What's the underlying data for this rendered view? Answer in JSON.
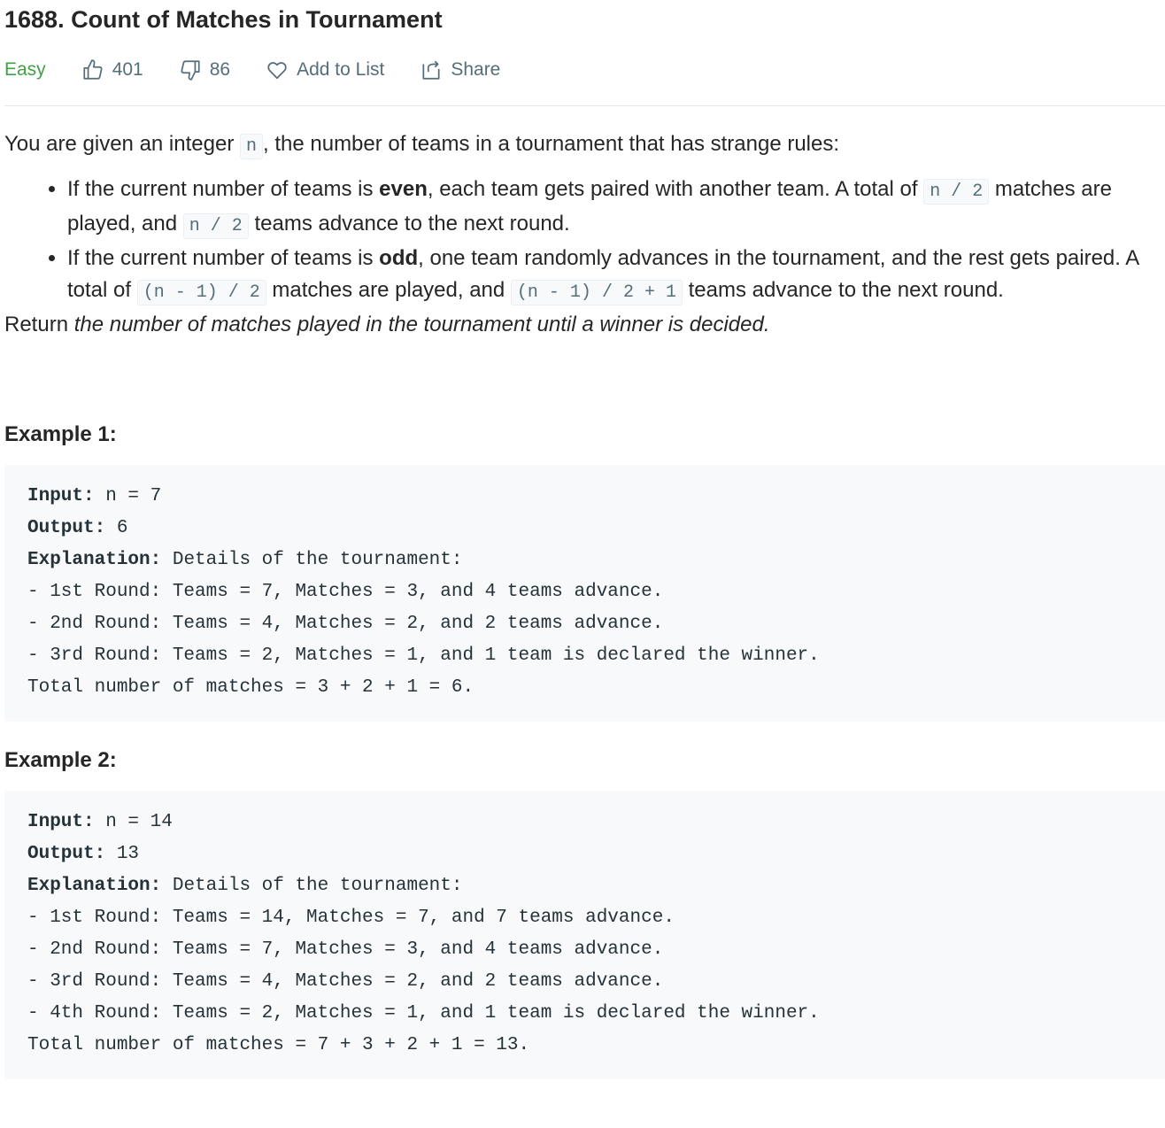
{
  "problem": {
    "title": "1688. Count of Matches in Tournament",
    "difficulty": "Easy",
    "likes": "401",
    "dislikes": "86",
    "add_to_list": "Add to List",
    "share": "Share"
  },
  "description": {
    "intro_before": "You are given an integer ",
    "intro_code": "n",
    "intro_after": ", the number of teams in a tournament that has strange rules:",
    "rule1": {
      "text1": "If the current number of teams is ",
      "bold": "even",
      "text2": ", each team gets paired with another team. A total of ",
      "code1": "n / 2",
      "text3": " matches are played, and ",
      "code2": "n / 2",
      "text4": " teams advance to the next round."
    },
    "rule2": {
      "text1": "If the current number of teams is ",
      "bold": "odd",
      "text2": ", one team randomly advances in the tournament, and the rest gets paired. A total of ",
      "code1": "(n - 1) / 2",
      "text3": " matches are played, and ",
      "code2": "(n - 1) / 2 + 1",
      "text4": " teams advance to the next round."
    },
    "return_before": "Return ",
    "return_italic": "the number of matches played in the tournament until a winner is decided.",
    "return_after": ""
  },
  "examples": [
    {
      "heading": "Example 1:",
      "input_label": "Input:",
      "input_value": " n = 7",
      "output_label": "Output:",
      "output_value": " 6",
      "explanation_label": "Explanation:",
      "explanation_value": " Details of the tournament:",
      "lines": [
        "- 1st Round: Teams = 7, Matches = 3, and 4 teams advance.",
        "- 2nd Round: Teams = 4, Matches = 2, and 2 teams advance.",
        "- 3rd Round: Teams = 2, Matches = 1, and 1 team is declared the winner.",
        "Total number of matches = 3 + 2 + 1 = 6."
      ]
    },
    {
      "heading": "Example 2:",
      "input_label": "Input:",
      "input_value": " n = 14",
      "output_label": "Output:",
      "output_value": " 13",
      "explanation_label": "Explanation:",
      "explanation_value": " Details of the tournament:",
      "lines": [
        "- 1st Round: Teams = 14, Matches = 7, and 7 teams advance.",
        "- 2nd Round: Teams = 7, Matches = 3, and 4 teams advance.",
        "- 3rd Round: Teams = 4, Matches = 2, and 2 teams advance.",
        "- 4th Round: Teams = 2, Matches = 1, and 1 team is declared the winner.",
        "Total number of matches = 7 + 3 + 2 + 1 = 13."
      ]
    }
  ],
  "icons": {
    "like": "thumbs-up-icon",
    "dislike": "thumbs-down-icon",
    "add_to_list": "heart-icon",
    "share": "share-icon"
  },
  "colors": {
    "difficulty_easy": "#43a047",
    "toolbar_text": "#546e7a",
    "code_background": "#f7f9fa"
  }
}
